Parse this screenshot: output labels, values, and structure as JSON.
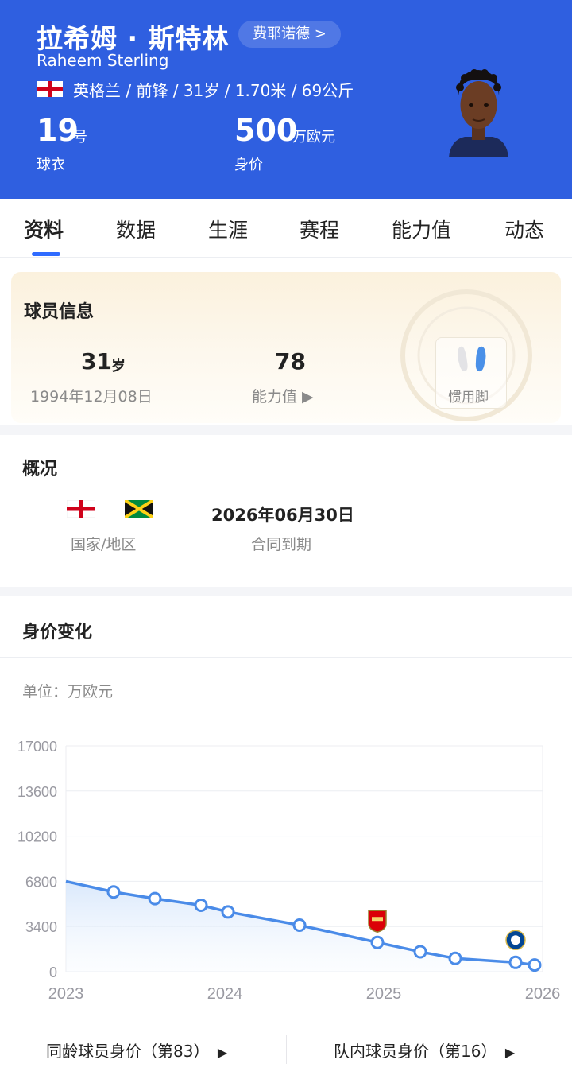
{
  "player": {
    "name_zh": "拉希姆 · 斯特林",
    "name_en": "Raheem Sterling",
    "club_link": "费耶诺德 >",
    "meta": "英格兰 / 前锋 / 31岁 / 1.70米 / 69公斤",
    "shirt_number": "19",
    "shirt_unit": "号",
    "shirt_label": "球衣",
    "market_value": "500",
    "market_value_unit": "万欧元",
    "market_value_label": "身价"
  },
  "tabs": [
    {
      "label": "资料",
      "active": true
    },
    {
      "label": "数据"
    },
    {
      "label": "生涯"
    },
    {
      "label": "赛程"
    },
    {
      "label": "能力值"
    },
    {
      "label": "动态"
    }
  ],
  "player_info": {
    "title": "球员信息",
    "age": "31",
    "age_unit": "岁",
    "birth_date": "1994年12月08日",
    "rating": "78",
    "rating_label": "能力值 ▶",
    "foot_label": "惯用脚"
  },
  "overview": {
    "title": "概况",
    "country_label": "国家/地区",
    "contract_date": "2026年06月30日",
    "contract_label": "合同到期"
  },
  "market_section": {
    "title": "身价变化",
    "unit": "单位：万欧元"
  },
  "chart_data": {
    "type": "line",
    "y_ticks": [
      "17000",
      "13600",
      "10200",
      "6800",
      "3400",
      "0"
    ],
    "x_ticks": [
      "2023",
      "2024",
      "2025",
      "2026"
    ],
    "ylim": [
      0,
      17000
    ],
    "xlim": [
      2023.0,
      2026.0
    ],
    "series": [
      {
        "x": [
          2023.0,
          2023.3,
          2023.56,
          2023.85,
          2024.02,
          2024.47,
          2024.96,
          2025.23,
          2025.45,
          2025.83,
          2025.95
        ],
        "y": [
          6800,
          6000,
          5500,
          5000,
          4500,
          3500,
          2200,
          1500,
          1000,
          700,
          500
        ]
      }
    ],
    "club_markers": [
      {
        "icon": "arsenal-crest-icon",
        "x": 2024.96
      },
      {
        "icon": "chelsea-crest-icon",
        "x": 2025.83
      }
    ],
    "line_color": "#4a8be8",
    "grid": true
  },
  "bottom_links": {
    "same_age": "同龄球员身价（第83）",
    "team": "队内球员身价（第16）"
  },
  "colors": {
    "header_bg": "#2f5fe0",
    "accent": "#2f6bff"
  }
}
